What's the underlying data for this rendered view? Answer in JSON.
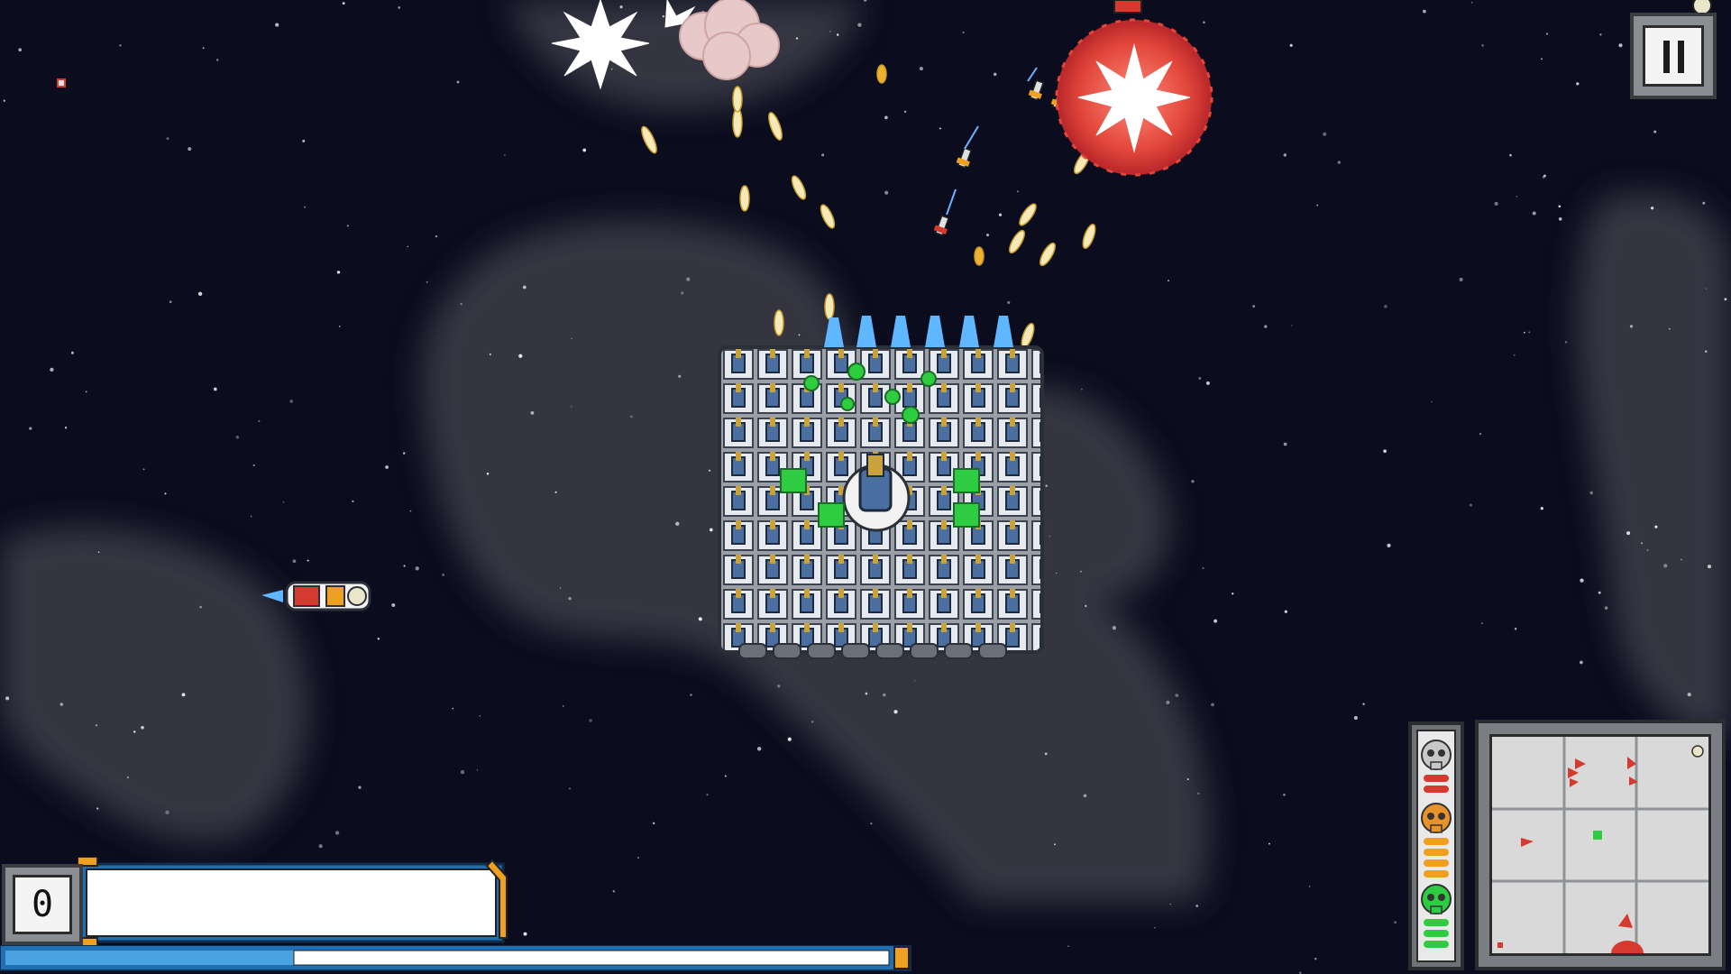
{
  "hud": {
    "score": "0",
    "pause_icon": "pause-icon",
    "threat_icons": [
      "skull-icon-grey",
      "skull-icon-orange",
      "skull-icon-green"
    ]
  },
  "colors": {
    "space": "#0b0d1e",
    "nebula": "#3a3b44",
    "hud_frame": "#8a8d92",
    "hud_blue": "#1f6fb5",
    "hud_orange": "#f0a020",
    "enemy_red": "#d63a2e",
    "player_green": "#2ecc40"
  }
}
